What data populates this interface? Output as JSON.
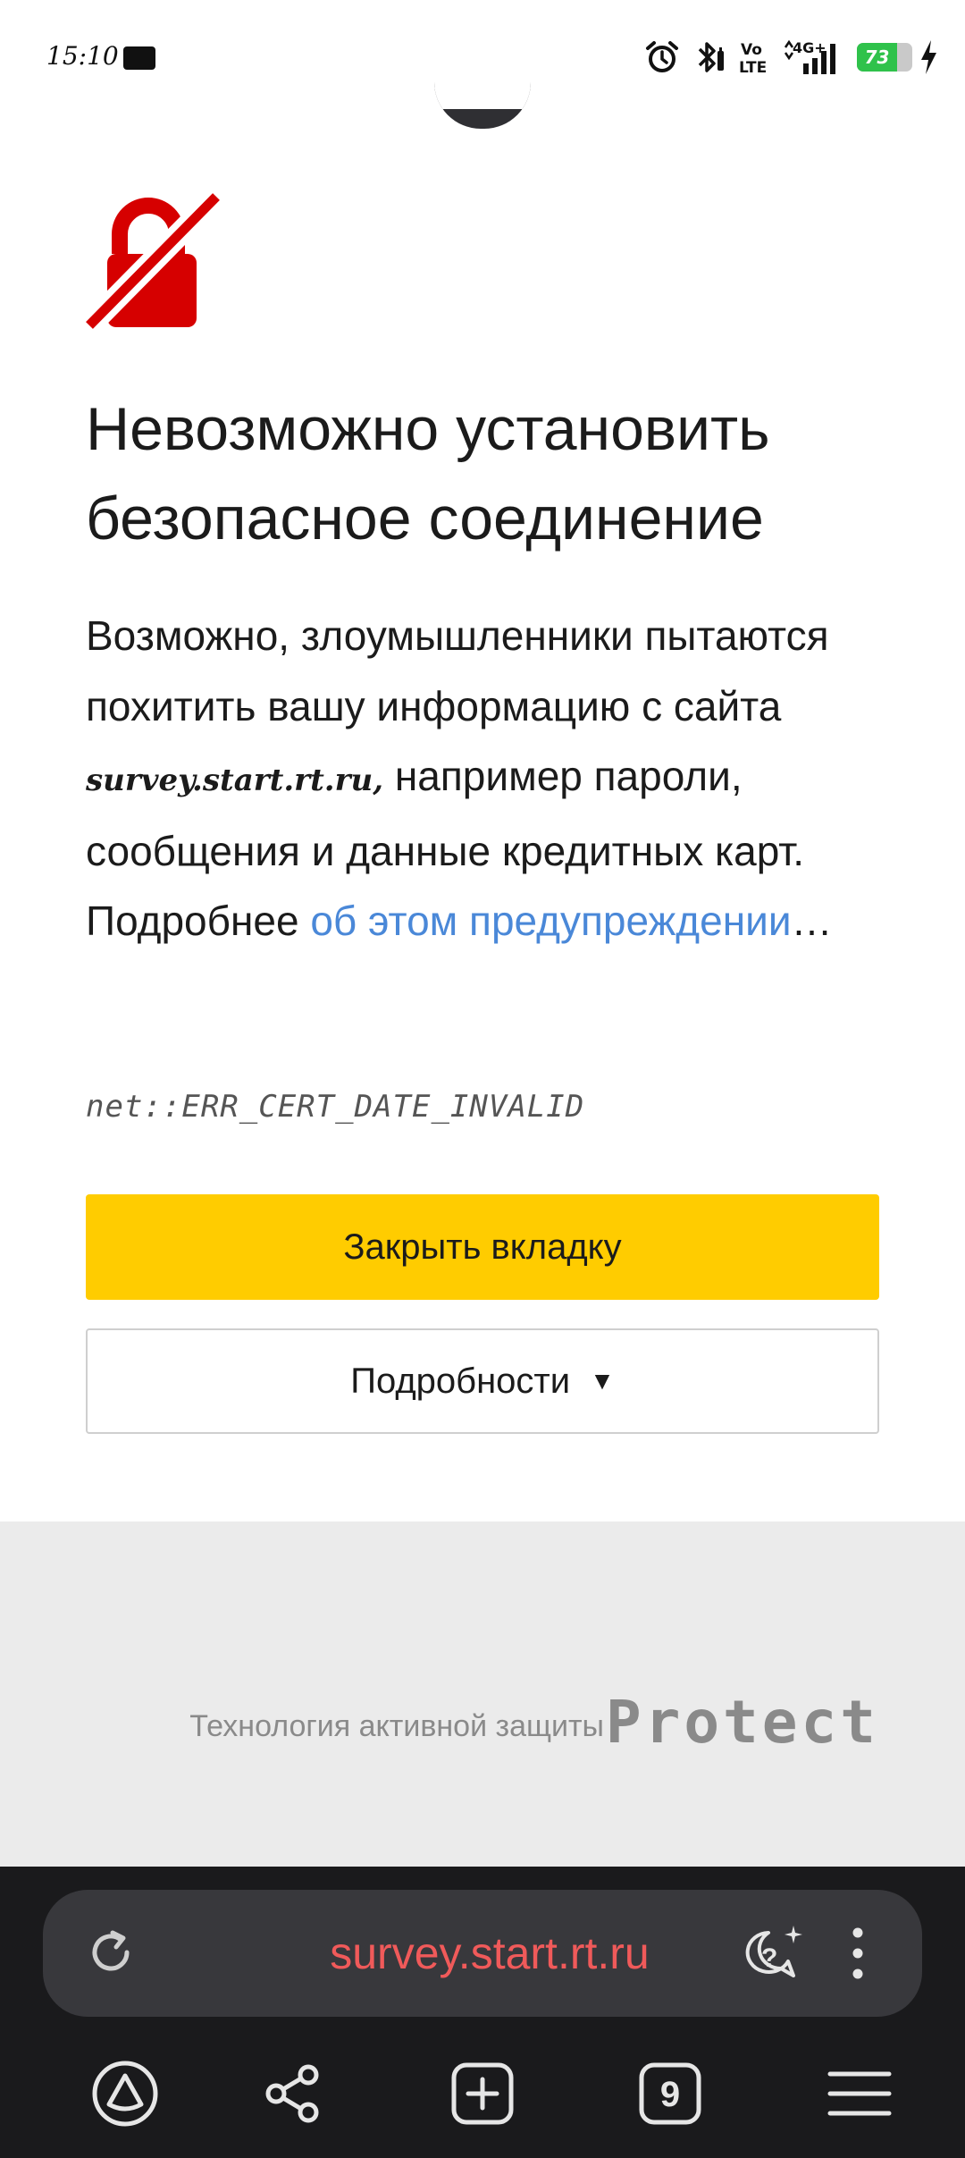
{
  "status_bar": {
    "time": "15:10",
    "volte_line1": "Vo",
    "volte_line2": "LTE",
    "network": "4G+",
    "battery_level": "73",
    "battery_percent": 73
  },
  "error_page": {
    "title": "Невозможно установить безопасное соединение",
    "warning_text_part1": "Возможно, злоумышленники пытаются похитить вашу информацию с сайта ",
    "domain": "survey.start.rt.ru,",
    "warning_text_part2": " например пароли, сообщения и данные кредитных карт. Подробнее ",
    "learn_more_link": "об этом предупреждении",
    "ellipsis": "…",
    "error_code": "net::ERR_CERT_DATE_INVALID",
    "close_tab_label": "Закрыть вкладку",
    "details_label": "Подробности",
    "details_arrow": "▼"
  },
  "protect": {
    "label": "Технология активной защиты",
    "logo_text": "Protect"
  },
  "browser": {
    "url": "survey.start.rt.ru",
    "tabs_count": "9",
    "accent_url_color": "#f05a5a"
  },
  "colors": {
    "primary_button": "#ffcc00",
    "link": "#4a88d8",
    "lock_icon": "#d60000",
    "footer_bg": "#ebebeb"
  }
}
